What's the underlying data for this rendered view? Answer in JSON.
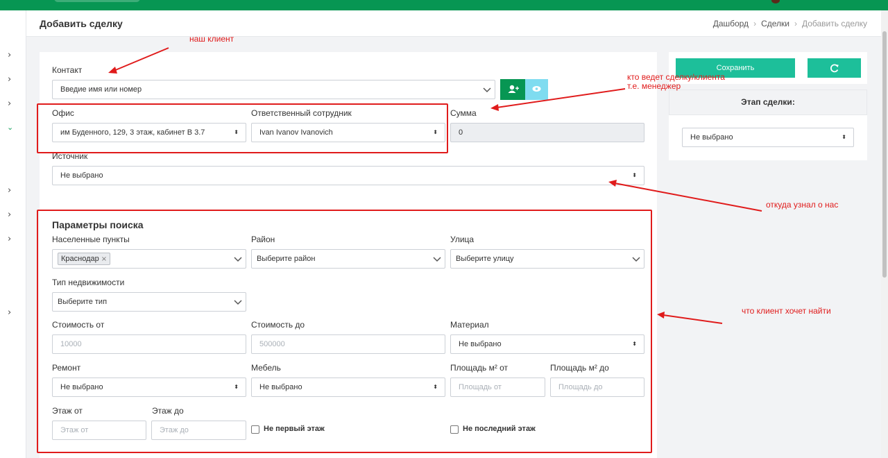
{
  "header": {
    "page_title": "Добавить сделку",
    "breadcrumb": [
      "Дашборд",
      "Сделки",
      "Добавить сделку"
    ]
  },
  "colors": {
    "brand": "#079653",
    "accent": "#1dbf9a",
    "cyan": "#7fdcf0",
    "annotation": "#e01b1b"
  },
  "sidebar": {
    "icons": [
      "chevron-right-icon",
      "chevron-right-icon",
      "chevron-right-icon",
      "chevron-down-icon",
      "chevron-right-icon",
      "chevron-right-icon",
      "chevron-right-icon",
      "chevron-right-icon"
    ]
  },
  "deal": {
    "contact_label": "Контакт",
    "contact_placeholder": "Введие имя или номер",
    "office_label": "Офис",
    "office_value": "им Буденного, 129, 3 этаж, кабинет В 3.7",
    "responsible_label": "Ответственный сотрудник",
    "responsible_value": "Ivan Ivanov Ivanovich",
    "sum_label": "Сумма",
    "sum_value": "0",
    "source_label": "Источник",
    "source_value": "Не выбрано"
  },
  "search": {
    "title": "Параметры поиска",
    "localities_label": "Населенные пункты",
    "locality_tag": "Краснодар",
    "district_label": "Район",
    "district_placeholder": "Выберите район",
    "street_label": "Улица",
    "street_placeholder": "Выберите улицу",
    "type_label": "Тип недвижимости",
    "type_placeholder": "Выберите тип",
    "price_from_label": "Стоимость от",
    "price_from_placeholder": "10000",
    "price_to_label": "Стоимость до",
    "price_to_placeholder": "500000",
    "material_label": "Материал",
    "material_value": "Не выбрано",
    "repair_label": "Ремонт",
    "repair_value": "Не выбрано",
    "furniture_label": "Мебель",
    "furniture_value": "Не выбрано",
    "area_from_label": "Площадь м² от",
    "area_from_placeholder": "Площадь от",
    "area_to_label": "Площадь м² до",
    "area_to_placeholder": "Площадь до",
    "floor_from_label": "Этаж от",
    "floor_from_placeholder": "Этаж от",
    "floor_to_label": "Этаж до",
    "floor_to_placeholder": "Этаж до",
    "not_first_floor": "Не первый этаж",
    "not_last_floor": "Не последний этаж"
  },
  "side_panel": {
    "save_label": "Сохранить",
    "stage_label": "Этап сделки:",
    "stage_value": "Не выбрано"
  },
  "annotations": {
    "client": "наш клиент",
    "manager_line1": "кто ведет сделку/клиента",
    "manager_line2": "т.е. менеджер",
    "source": "откуда узнал о нас",
    "wants": "что клиент хочет найти"
  }
}
